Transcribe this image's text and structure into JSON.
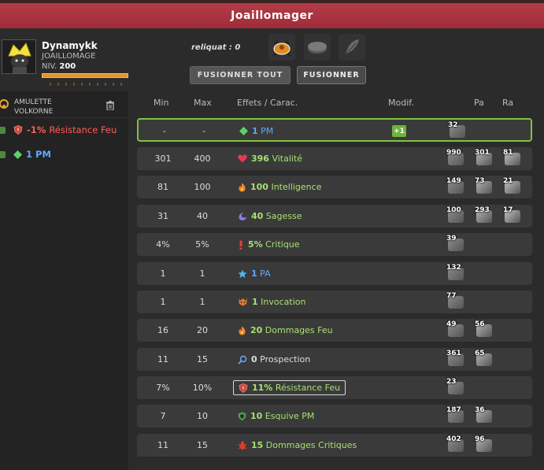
{
  "window": {
    "title": "Joaillomager"
  },
  "player": {
    "name": "Dynamykk",
    "job": "JOAILLOMAGE",
    "level_label": "NIV.",
    "level": "200",
    "xp_fraction": 1.0
  },
  "reliquat": "reliquat : 0",
  "buttons": {
    "fuse_all": "FUSIONNER TOUT",
    "fuse": "FUSIONNER"
  },
  "slots": [
    {
      "icon": "orange-rune-icon"
    },
    {
      "icon": "grey-stone-icon"
    },
    {
      "icon": "feather-icon"
    }
  ],
  "sidebar": {
    "item_name": "AMULETTE VOLKORNE",
    "lines": [
      {
        "value": "-1%",
        "label": "Résistance Feu",
        "color": "#ff5c57",
        "icon": "fire-resistance-icon"
      },
      {
        "value": "1",
        "label": "PM",
        "color": "#61a8ff",
        "icon": "pm-diamond-icon"
      }
    ]
  },
  "columns": {
    "min": "Min",
    "max": "Max",
    "effects": "Effets / Carac.",
    "modif": "Modif.",
    "pa": "Pa",
    "ra": "Ra"
  },
  "rows": [
    {
      "min": "-",
      "max": "-",
      "value": "1",
      "label": "PM",
      "style": "blue",
      "icon": "pm-diamond-icon",
      "modif": "+1",
      "highlight": true,
      "runes": [
        "32"
      ]
    },
    {
      "min": "301",
      "max": "400",
      "value": "396",
      "label": "Vitalité",
      "style": "green",
      "icon": "heart-icon",
      "runes": [
        "990",
        "301",
        "81"
      ]
    },
    {
      "min": "81",
      "max": "100",
      "value": "100",
      "label": "Intelligence",
      "style": "green",
      "icon": "fire-icon",
      "runes": [
        "149",
        "73",
        "21"
      ]
    },
    {
      "min": "31",
      "max": "40",
      "value": "40",
      "label": "Sagesse",
      "style": "green",
      "icon": "moon-icon",
      "runes": [
        "100",
        "293",
        "17"
      ]
    },
    {
      "min": "4%",
      "max": "5%",
      "value": "5%",
      "label": "Critique",
      "style": "green",
      "icon": "exclamation-icon",
      "runes": [
        "39"
      ]
    },
    {
      "min": "1",
      "max": "1",
      "value": "1",
      "label": "PA",
      "style": "blue",
      "icon": "star-icon",
      "runes": [
        "132"
      ]
    },
    {
      "min": "1",
      "max": "1",
      "value": "1",
      "label": "Invocation",
      "style": "green",
      "icon": "invocation-icon",
      "runes": [
        "77"
      ]
    },
    {
      "min": "16",
      "max": "20",
      "value": "20",
      "label": "Dommages Feu",
      "style": "green",
      "icon": "fire-icon",
      "runes": [
        "49",
        "56"
      ]
    },
    {
      "min": "11",
      "max": "15",
      "value": "0",
      "label": "Prospection",
      "style": "grey",
      "icon": "magnifier-icon",
      "runes": [
        "361",
        "65"
      ]
    },
    {
      "min": "7%",
      "max": "10%",
      "value": "11%",
      "label": "Résistance Feu",
      "style": "green",
      "icon": "fire-resistance-icon",
      "boxed": true,
      "runes": [
        "23"
      ]
    },
    {
      "min": "7",
      "max": "10",
      "value": "10",
      "label": "Esquive PM",
      "style": "green",
      "icon": "shield-icon",
      "runes": [
        "187",
        "36"
      ]
    },
    {
      "min": "11",
      "max": "15",
      "value": "15",
      "label": "Dommages Critiques",
      "style": "green",
      "icon": "bug-icon",
      "runes": [
        "402",
        "96"
      ]
    }
  ]
}
